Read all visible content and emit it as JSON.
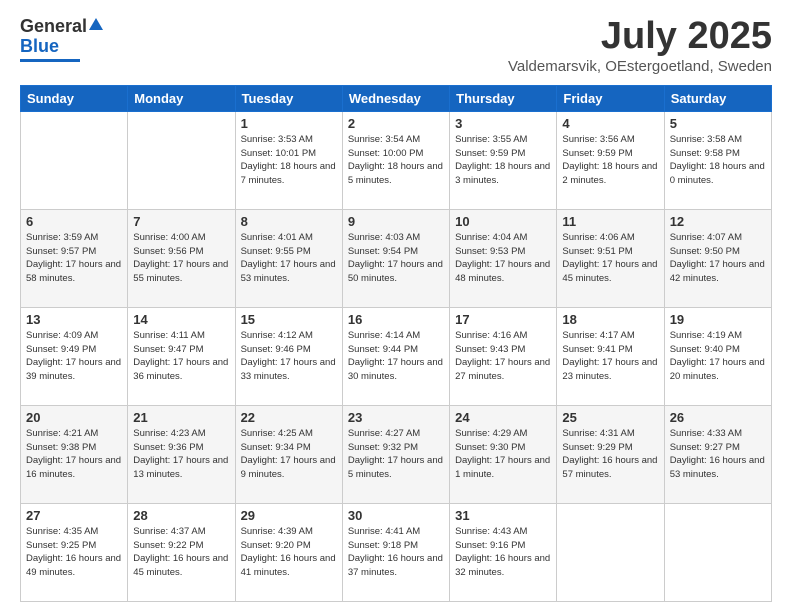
{
  "header": {
    "logo_general": "General",
    "logo_blue": "Blue",
    "title": "July 2025",
    "subtitle": "Valdemarsvik, OEstergoetland, Sweden"
  },
  "days_of_week": [
    "Sunday",
    "Monday",
    "Tuesday",
    "Wednesday",
    "Thursday",
    "Friday",
    "Saturday"
  ],
  "weeks": [
    [
      {
        "day": "",
        "info": ""
      },
      {
        "day": "",
        "info": ""
      },
      {
        "day": "1",
        "info": "Sunrise: 3:53 AM\nSunset: 10:01 PM\nDaylight: 18 hours and 7 minutes."
      },
      {
        "day": "2",
        "info": "Sunrise: 3:54 AM\nSunset: 10:00 PM\nDaylight: 18 hours and 5 minutes."
      },
      {
        "day": "3",
        "info": "Sunrise: 3:55 AM\nSunset: 9:59 PM\nDaylight: 18 hours and 3 minutes."
      },
      {
        "day": "4",
        "info": "Sunrise: 3:56 AM\nSunset: 9:59 PM\nDaylight: 18 hours and 2 minutes."
      },
      {
        "day": "5",
        "info": "Sunrise: 3:58 AM\nSunset: 9:58 PM\nDaylight: 18 hours and 0 minutes."
      }
    ],
    [
      {
        "day": "6",
        "info": "Sunrise: 3:59 AM\nSunset: 9:57 PM\nDaylight: 17 hours and 58 minutes."
      },
      {
        "day": "7",
        "info": "Sunrise: 4:00 AM\nSunset: 9:56 PM\nDaylight: 17 hours and 55 minutes."
      },
      {
        "day": "8",
        "info": "Sunrise: 4:01 AM\nSunset: 9:55 PM\nDaylight: 17 hours and 53 minutes."
      },
      {
        "day": "9",
        "info": "Sunrise: 4:03 AM\nSunset: 9:54 PM\nDaylight: 17 hours and 50 minutes."
      },
      {
        "day": "10",
        "info": "Sunrise: 4:04 AM\nSunset: 9:53 PM\nDaylight: 17 hours and 48 minutes."
      },
      {
        "day": "11",
        "info": "Sunrise: 4:06 AM\nSunset: 9:51 PM\nDaylight: 17 hours and 45 minutes."
      },
      {
        "day": "12",
        "info": "Sunrise: 4:07 AM\nSunset: 9:50 PM\nDaylight: 17 hours and 42 minutes."
      }
    ],
    [
      {
        "day": "13",
        "info": "Sunrise: 4:09 AM\nSunset: 9:49 PM\nDaylight: 17 hours and 39 minutes."
      },
      {
        "day": "14",
        "info": "Sunrise: 4:11 AM\nSunset: 9:47 PM\nDaylight: 17 hours and 36 minutes."
      },
      {
        "day": "15",
        "info": "Sunrise: 4:12 AM\nSunset: 9:46 PM\nDaylight: 17 hours and 33 minutes."
      },
      {
        "day": "16",
        "info": "Sunrise: 4:14 AM\nSunset: 9:44 PM\nDaylight: 17 hours and 30 minutes."
      },
      {
        "day": "17",
        "info": "Sunrise: 4:16 AM\nSunset: 9:43 PM\nDaylight: 17 hours and 27 minutes."
      },
      {
        "day": "18",
        "info": "Sunrise: 4:17 AM\nSunset: 9:41 PM\nDaylight: 17 hours and 23 minutes."
      },
      {
        "day": "19",
        "info": "Sunrise: 4:19 AM\nSunset: 9:40 PM\nDaylight: 17 hours and 20 minutes."
      }
    ],
    [
      {
        "day": "20",
        "info": "Sunrise: 4:21 AM\nSunset: 9:38 PM\nDaylight: 17 hours and 16 minutes."
      },
      {
        "day": "21",
        "info": "Sunrise: 4:23 AM\nSunset: 9:36 PM\nDaylight: 17 hours and 13 minutes."
      },
      {
        "day": "22",
        "info": "Sunrise: 4:25 AM\nSunset: 9:34 PM\nDaylight: 17 hours and 9 minutes."
      },
      {
        "day": "23",
        "info": "Sunrise: 4:27 AM\nSunset: 9:32 PM\nDaylight: 17 hours and 5 minutes."
      },
      {
        "day": "24",
        "info": "Sunrise: 4:29 AM\nSunset: 9:30 PM\nDaylight: 17 hours and 1 minute."
      },
      {
        "day": "25",
        "info": "Sunrise: 4:31 AM\nSunset: 9:29 PM\nDaylight: 16 hours and 57 minutes."
      },
      {
        "day": "26",
        "info": "Sunrise: 4:33 AM\nSunset: 9:27 PM\nDaylight: 16 hours and 53 minutes."
      }
    ],
    [
      {
        "day": "27",
        "info": "Sunrise: 4:35 AM\nSunset: 9:25 PM\nDaylight: 16 hours and 49 minutes."
      },
      {
        "day": "28",
        "info": "Sunrise: 4:37 AM\nSunset: 9:22 PM\nDaylight: 16 hours and 45 minutes."
      },
      {
        "day": "29",
        "info": "Sunrise: 4:39 AM\nSunset: 9:20 PM\nDaylight: 16 hours and 41 minutes."
      },
      {
        "day": "30",
        "info": "Sunrise: 4:41 AM\nSunset: 9:18 PM\nDaylight: 16 hours and 37 minutes."
      },
      {
        "day": "31",
        "info": "Sunrise: 4:43 AM\nSunset: 9:16 PM\nDaylight: 16 hours and 32 minutes."
      },
      {
        "day": "",
        "info": ""
      },
      {
        "day": "",
        "info": ""
      }
    ]
  ]
}
